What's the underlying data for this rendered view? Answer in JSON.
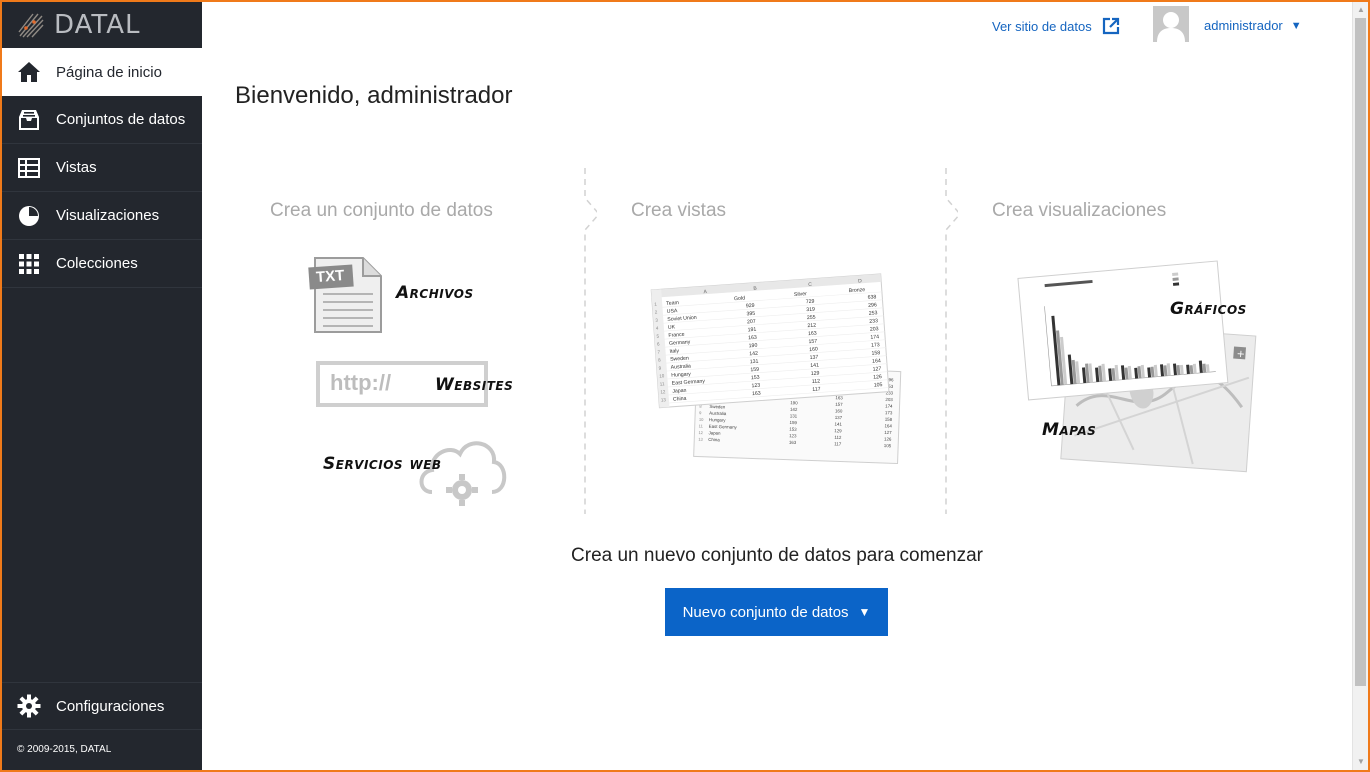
{
  "app": {
    "logo_text": "DATAL"
  },
  "sidebar": {
    "items": [
      {
        "label": "Página de inicio",
        "icon": "home-icon"
      },
      {
        "label": "Conjuntos de datos",
        "icon": "inbox-icon"
      },
      {
        "label": "Vistas",
        "icon": "table-icon"
      },
      {
        "label": "Visualizaciones",
        "icon": "pie-chart-icon"
      },
      {
        "label": "Colecciones",
        "icon": "grid-icon"
      }
    ],
    "settings_label": "Configuraciones",
    "copyright": "© 2009-2015, DATAL"
  },
  "header": {
    "view_site_label": "Ver sitio de datos",
    "user_name": "administrador",
    "caret": "▼"
  },
  "main": {
    "welcome": "Bienvenido, administrador",
    "steps": [
      {
        "title": "Crea un conjunto de datos"
      },
      {
        "title": "Crea vistas"
      },
      {
        "title": "Crea visualizaciones"
      }
    ],
    "dataset_sources": {
      "file_badge": "TXT",
      "files_label": "Archivos",
      "url_text": "http://",
      "websites_label": "Websites",
      "webservices_label": "Servicios web"
    },
    "viz_types": {
      "charts_label": "Gráficos",
      "maps_label": "Mapas"
    },
    "sheet": {
      "columns": [
        "A",
        "B",
        "C",
        "D"
      ],
      "headers": [
        "Team",
        "Gold",
        "Silver",
        "Bronze"
      ],
      "rows": [
        [
          "USA",
          "929",
          "729",
          "638"
        ],
        [
          "Soviet Union",
          "395",
          "319",
          "296"
        ],
        [
          "UK",
          "207",
          "255",
          "253"
        ],
        [
          "France",
          "191",
          "212",
          "233"
        ],
        [
          "Germany",
          "163",
          "163",
          "203"
        ],
        [
          "Italy",
          "190",
          "157",
          "174"
        ],
        [
          "Sweden",
          "142",
          "160",
          "173"
        ],
        [
          "Australia",
          "131",
          "137",
          "158"
        ],
        [
          "Hungary",
          "159",
          "141",
          "164"
        ],
        [
          "East Germany",
          "153",
          "129",
          "127"
        ],
        [
          "Japan",
          "123",
          "112",
          "126"
        ],
        [
          "China",
          "163",
          "117",
          "105"
        ]
      ]
    },
    "cta_text": "Crea un nuevo conjunto de datos para comenzar",
    "cta_button": "Nuevo conjunto de datos"
  },
  "colors": {
    "sidebar_bg": "#23272e",
    "accent": "#0b64c8",
    "link": "#1565c0",
    "frame": "#f07a1a"
  }
}
